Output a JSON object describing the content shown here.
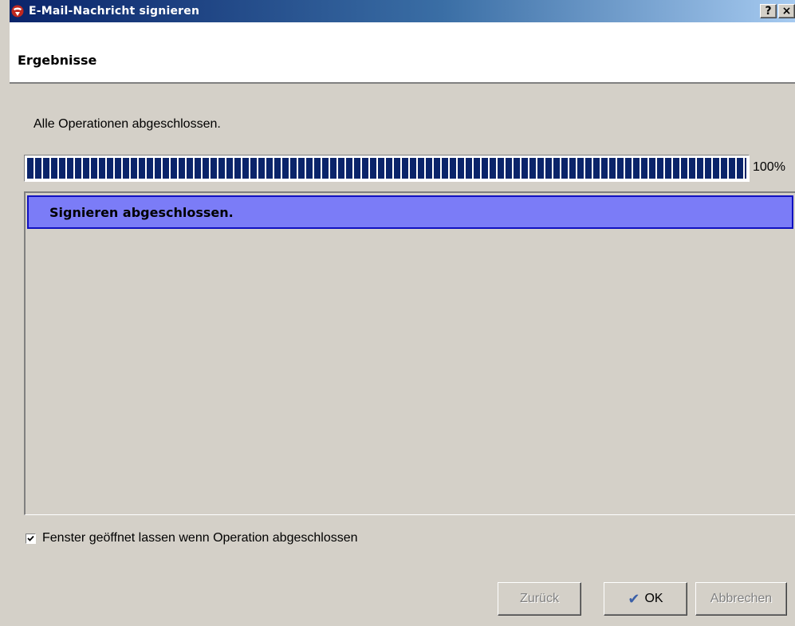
{
  "window": {
    "title": "E-Mail-Nachricht signieren",
    "help_button": "?",
    "close_button": "×"
  },
  "header": {
    "title": "Ergebnisse"
  },
  "main": {
    "status_text": "Alle Operationen abgeschlossen.",
    "progress": {
      "value": 100,
      "label": "100%"
    },
    "log": {
      "items": [
        {
          "label": "Signieren abgeschlossen."
        }
      ]
    },
    "keep_open": {
      "checked": true,
      "label": "Fenster geöffnet lassen wenn Operation abgeschlossen"
    }
  },
  "buttons": {
    "back_label": "Zurück",
    "ok_label": "OK",
    "cancel_label": "Abbrechen"
  },
  "colors": {
    "titlebar_start": "#0a246a",
    "titlebar_end": "#a6caf0",
    "progress_fill": "#0a246a",
    "log_selected_bg": "#7b7cf7",
    "dialog_bg": "#d4d0c8"
  }
}
